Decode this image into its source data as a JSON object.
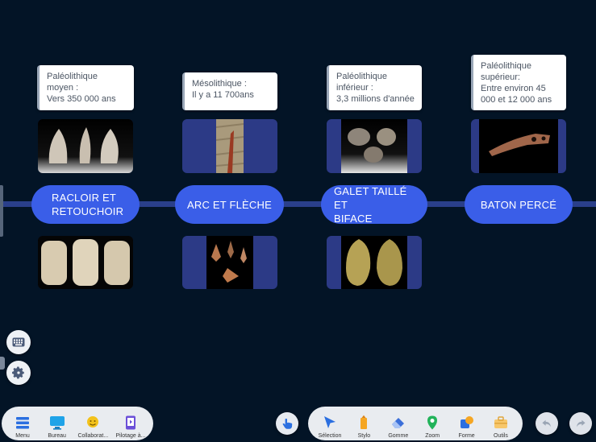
{
  "timeline": {
    "items": [
      {
        "id": "racloir",
        "title_line1": "RACLOIR ET",
        "title_line2": "RETOUCHOIR",
        "info_lines": [
          "Paléolithique",
          "moyen :",
          "Vers 350 000 ans"
        ],
        "top_image": "three-flint-points",
        "bottom_image": "three-scrapers"
      },
      {
        "id": "arc",
        "title_line1": "ARC ET FLÈCHE",
        "title_line2": "",
        "info_lines": [
          "Mésolithique :",
          "Il y a 11 700ans"
        ],
        "top_image": "arrow-on-wood",
        "bottom_image": "arrowheads"
      },
      {
        "id": "galet",
        "title_line1": "GALET TAILLÉ ET",
        "title_line2": "BIFACE",
        "info_lines": [
          "Paléolithique",
          "inférieur :",
          "3,3 millions d'année"
        ],
        "top_image": "pebble-tools",
        "bottom_image": "bifaces"
      },
      {
        "id": "baton",
        "title_line1": "BATON PERCÉ",
        "title_line2": "",
        "info_lines": [
          "Paléolithique",
          "supérieur:",
          "Entre environ 45",
          "000 et 12 000 ans"
        ],
        "top_image": "perforated-baton",
        "bottom_image": ""
      }
    ]
  },
  "toolbar_left": [
    {
      "label": "Menu",
      "icon": "menu-icon"
    },
    {
      "label": "Bureau",
      "icon": "desktop-icon"
    },
    {
      "label": "Collaborat...",
      "icon": "collaboration-icon"
    },
    {
      "label": "Pilotage à...",
      "icon": "remote-control-icon"
    }
  ],
  "toolbar_right": [
    {
      "label": "Sélection",
      "icon": "cursor-icon"
    },
    {
      "label": "Stylo",
      "icon": "pen-icon"
    },
    {
      "label": "Gomme",
      "icon": "eraser-icon"
    },
    {
      "label": "Zoom",
      "icon": "zoom-pin-icon"
    },
    {
      "label": "Forme",
      "icon": "shape-icon"
    },
    {
      "label": "Outils",
      "icon": "toolbox-icon"
    }
  ],
  "colors": {
    "background": "#031426",
    "accent": "#3a5ee8",
    "card": "#2c3a86",
    "line": "#2a3f8a"
  }
}
